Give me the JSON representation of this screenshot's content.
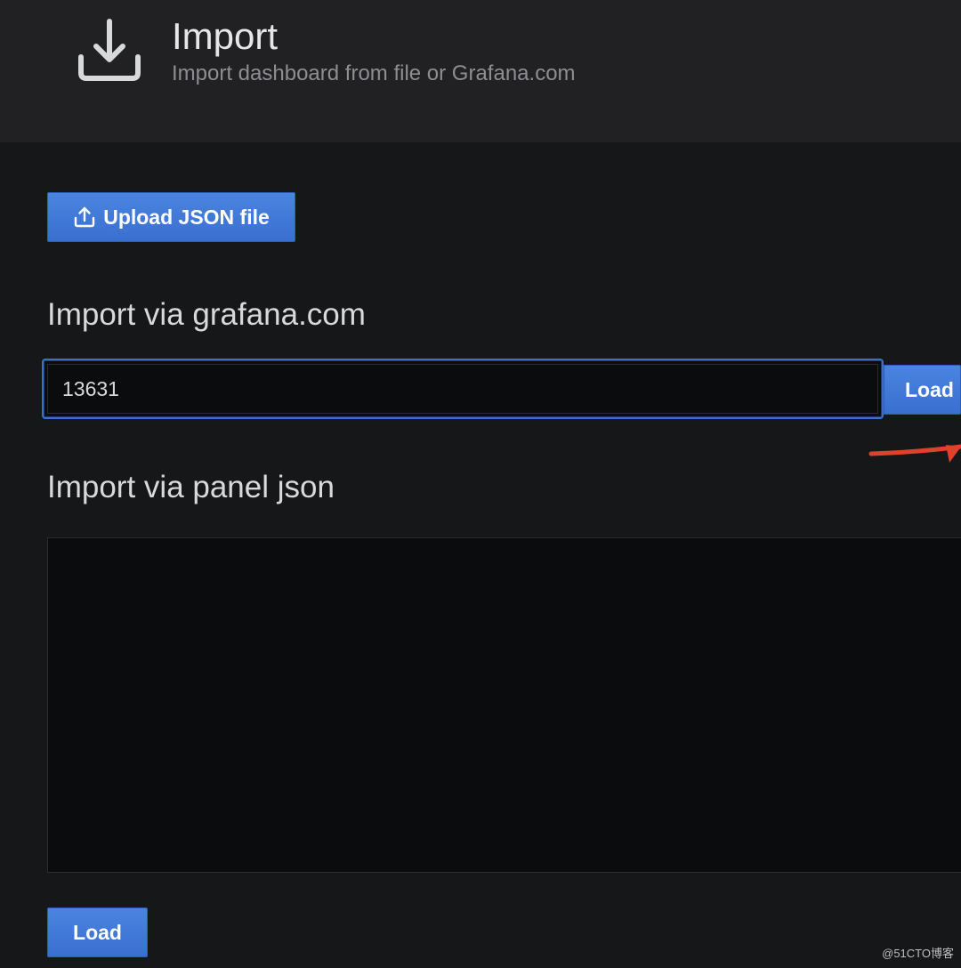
{
  "header": {
    "icon": "download-icon",
    "title": "Import",
    "subtitle": "Import dashboard from file or Grafana.com"
  },
  "upload": {
    "label": "Upload JSON file",
    "icon": "upload-icon"
  },
  "grafana_com": {
    "heading": "Import via grafana.com",
    "input_value": "13631",
    "load_label": "Load"
  },
  "panel_json": {
    "heading": "Import via panel json",
    "textarea_value": "",
    "load_label": "Load"
  },
  "watermark": "@51CTO博客",
  "colors": {
    "background": "#161719",
    "header_background": "#212124",
    "primary_button": "#3a6fd0",
    "input_focus_border": "#3a6fd0",
    "annotation_arrow": "#e0412c"
  }
}
